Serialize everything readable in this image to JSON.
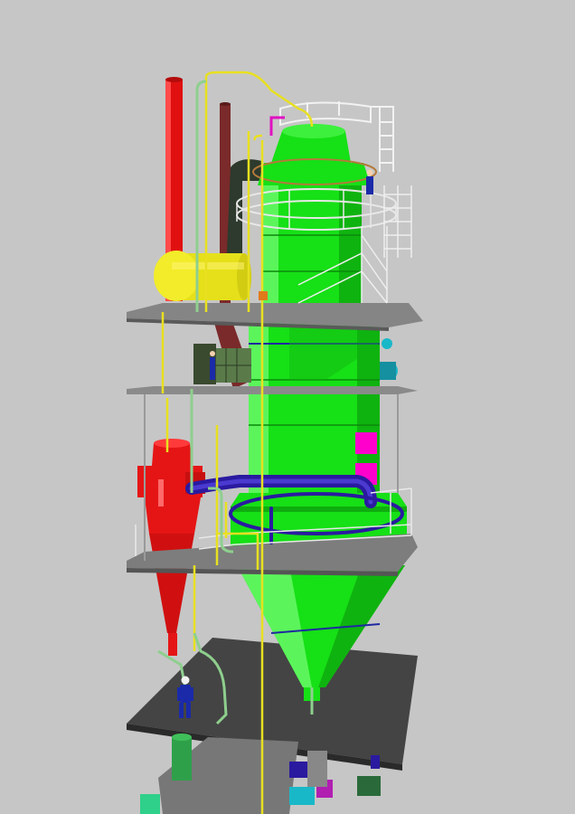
{
  "scene": {
    "background": "#c6c6c6",
    "colors": {
      "tower": "#16e016",
      "tower_shade": "#0fb30f",
      "stack_red": "#e01010",
      "stack_maroon": "#7a2a2a",
      "tank_yellow": "#e6e01a",
      "cyclone_red": "#e51515",
      "duct_blue": "#2a1aa0",
      "panel_magenta": "#ff00cc",
      "platform_gray": "#7d7d7d",
      "floor_dark": "#3a3a3a",
      "railing": "#f2f2f2",
      "pipe_yellow": "#e8e020",
      "pipe_green": "#8ecf8e",
      "worker_blue": "#1a2aa8",
      "fan_cyan": "#19b8c8"
    }
  }
}
